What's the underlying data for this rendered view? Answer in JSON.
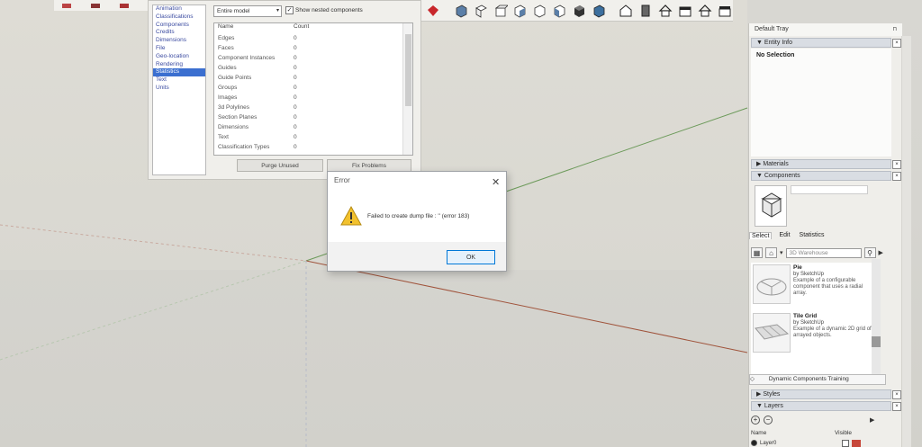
{
  "colors": {
    "accent": "#0078d7",
    "selection": "#3b6fd0",
    "warning": "#f2c12e",
    "axis_green": "#6c9a5a",
    "axis_red": "#a0543c",
    "layer_red": "#c7473a"
  },
  "model_info": {
    "categories": [
      "Animation",
      "Classifications",
      "Components",
      "Credits",
      "Dimensions",
      "File",
      "Geo-location",
      "Rendering",
      "Statistics",
      "Text",
      "Units"
    ],
    "selected_category": "Statistics",
    "scope_select": "Entire model",
    "nested_label": "Show nested components",
    "nested_checked": true,
    "header_name": "Name",
    "header_count": "Count",
    "rows": [
      {
        "name": "Edges",
        "count": "0"
      },
      {
        "name": "Faces",
        "count": "0"
      },
      {
        "name": "Component Instances",
        "count": "0"
      },
      {
        "name": "Guides",
        "count": "0"
      },
      {
        "name": "Guide Points",
        "count": "0"
      },
      {
        "name": "Groups",
        "count": "0"
      },
      {
        "name": "Images",
        "count": "0"
      },
      {
        "name": "3d Polylines",
        "count": "0"
      },
      {
        "name": "Section Planes",
        "count": "0"
      },
      {
        "name": "Dimensions",
        "count": "0"
      },
      {
        "name": "Text",
        "count": "0"
      },
      {
        "name": "Classification Types",
        "count": "0"
      }
    ],
    "purge_label": "Purge Unused",
    "fix_label": "Fix Problems"
  },
  "error_dialog": {
    "title": "Error",
    "message": "Failed to create dump file : '' (error 183)",
    "ok_label": "OK",
    "close_glyph": "✕"
  },
  "toolbar": {
    "icons": [
      "ruby-console-icon",
      "iso-view-icon",
      "top-view-icon",
      "front-view-icon",
      "right-view-icon",
      "back-view-icon",
      "left-view-icon",
      "wireframe-style-icon",
      "shaded-style-icon",
      "warehouse-icon",
      "extension-icon",
      "home-icon",
      "house-front-icon",
      "house-icon",
      "roof-icon"
    ]
  },
  "tray": {
    "title": "Default Tray",
    "entity_info": {
      "label": "Entity Info",
      "status": "No Selection"
    },
    "materials": {
      "label": "Materials"
    },
    "components": {
      "label": "Components",
      "tabs": [
        "Select",
        "Edit",
        "Statistics"
      ],
      "search_placeholder": "3D Warehouse",
      "entries": [
        {
          "title": "Pie",
          "by": "by SketchUp",
          "desc": "Example of a configurable component that uses a radial array."
        },
        {
          "title": "Tile Grid",
          "by": "by SketchUp",
          "desc": "Example of a dynamic 2D grid of arrayed objects."
        }
      ],
      "footer_label": "Dynamic Components Training"
    },
    "styles": {
      "label": "Styles"
    },
    "layers": {
      "label": "Layers",
      "col_name": "Name",
      "col_visible": "Visible",
      "layer_name": "Layer0"
    }
  }
}
